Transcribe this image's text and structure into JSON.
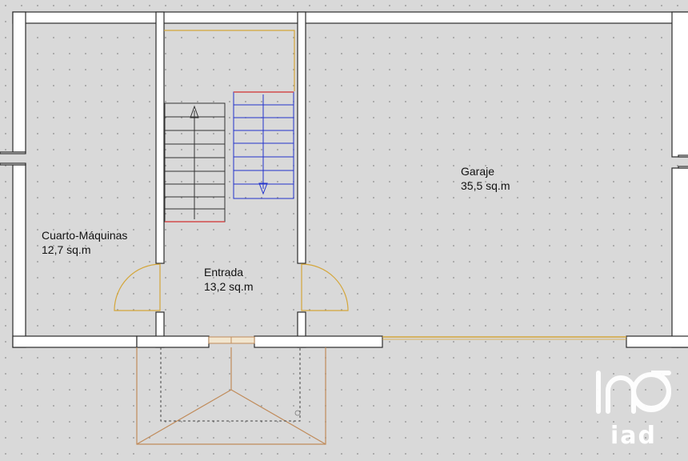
{
  "rooms": {
    "cuarto": {
      "name": "Cuarto-Máquinas",
      "area": "12,7 sq.m"
    },
    "entrada": {
      "name": "Entrada",
      "area": "13,2 sq.m"
    },
    "garaje": {
      "name": "Garaje",
      "area": "35,5 sq.m"
    }
  },
  "logo": {
    "text": "iad"
  },
  "colors": {
    "background": "#d9d9d9",
    "grid_dot": "#8c8c8c",
    "wall_fill": "#ffffff",
    "wall_stroke": "#2b2b2b",
    "door_swing": "#d4a63a",
    "stair_up": "#333333",
    "stair_down": "#2233cc",
    "stair_edge": "#d24a4a",
    "porch": "#c08b5a",
    "logo": "#ffffff"
  }
}
